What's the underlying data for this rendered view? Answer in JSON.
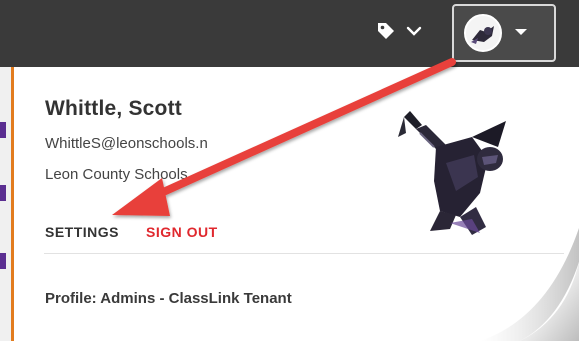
{
  "topbar": {
    "tag_icon": "tag-icon",
    "tag_chevron": "chevron-down-icon",
    "avatar_chevron": "caret-down-icon",
    "background": "#3a3a3a"
  },
  "profile": {
    "name": "Whittle, Scott",
    "email": "WhittleS@leonschools.n",
    "organization": "Leon County Schools",
    "avatar_icon": "armored-hero-avatar"
  },
  "actions": {
    "settings_label": "SETTINGS",
    "signout_label": "SIGN OUT"
  },
  "footer": {
    "profile_text": "Profile: Admins - ClassLink Tenant"
  },
  "colors": {
    "accent_red": "#e0282e",
    "arrow_red": "#e8413a",
    "left_accent": "#e27c1e",
    "text_dark": "#333333"
  }
}
